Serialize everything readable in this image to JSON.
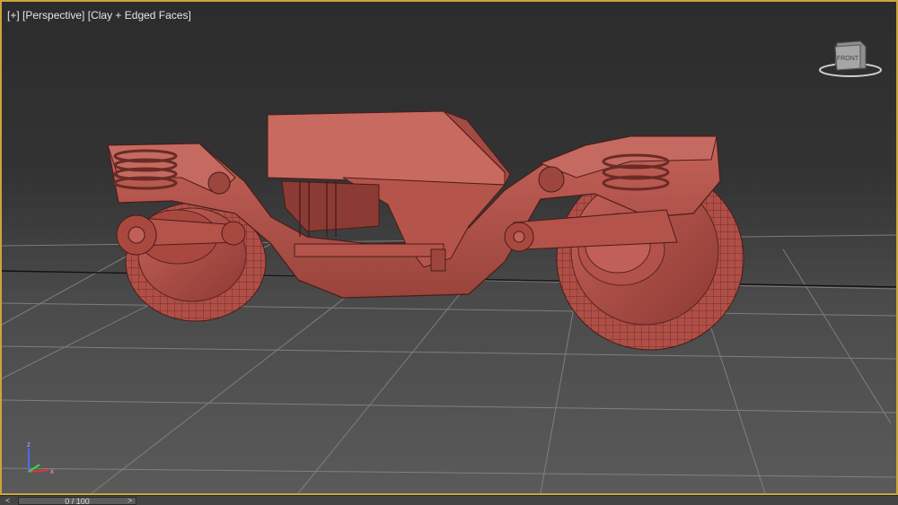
{
  "viewport": {
    "menu_plus": "[+]",
    "view_mode": "[Perspective]",
    "shading_mode": "[Clay + Edged Faces]",
    "viewcube_face": "FRONT",
    "axis_z": "z",
    "axis_x": "x",
    "accent_border_color": "#c9a53a",
    "model_color": "#b8554c"
  },
  "timeline": {
    "frame_readout": "0 / 100",
    "prev_glyph": "<",
    "next_glyph": ">"
  }
}
